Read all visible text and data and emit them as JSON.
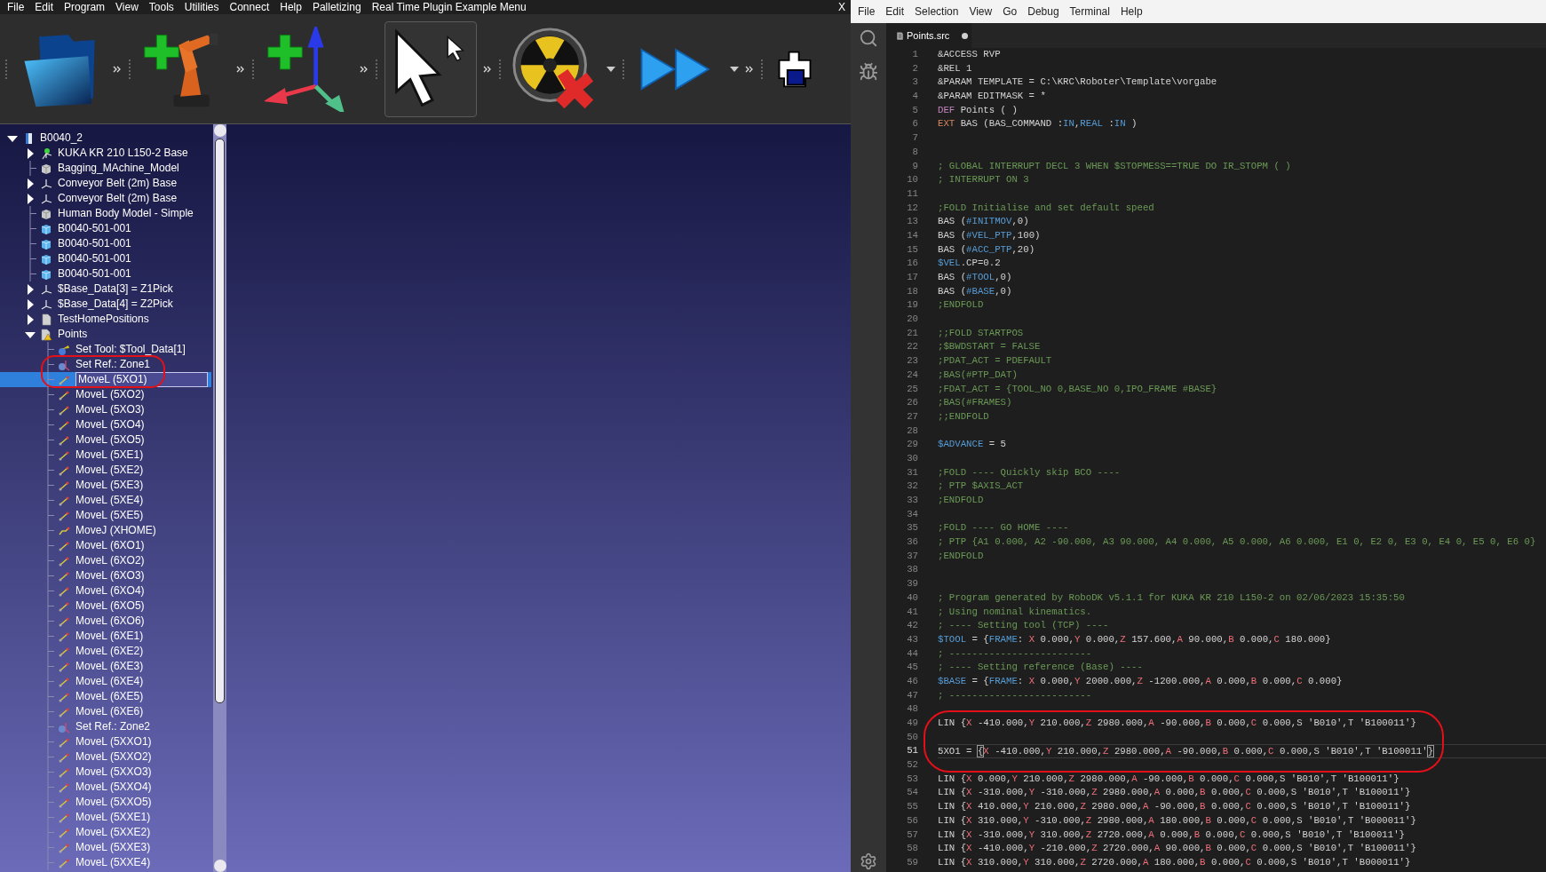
{
  "robodk": {
    "menu": [
      "File",
      "Edit",
      "Program",
      "View",
      "Tools",
      "Utilities",
      "Connect",
      "Help",
      "Palletizing",
      "Real Time Plugin Example Menu"
    ],
    "close": "X",
    "toolbar": [
      {
        "kind": "folder",
        "selected": false,
        "dropdown": false,
        "overflow": true
      },
      {
        "kind": "robot",
        "selected": false,
        "dropdown": false,
        "overflow": true
      },
      {
        "kind": "frame",
        "selected": false,
        "dropdown": false,
        "overflow": true
      },
      {
        "kind": "pointer",
        "selected": true,
        "dropdown": false,
        "overflow": true
      },
      {
        "kind": "radiation",
        "selected": false,
        "dropdown": true,
        "overflow": false
      },
      {
        "kind": "play",
        "selected": false,
        "dropdown": true,
        "overflow": true
      },
      {
        "kind": "print",
        "selected": false,
        "dropdown": false,
        "overflow": false
      }
    ],
    "tree": [
      {
        "label": "B0040_2",
        "kind": "station",
        "expanded": true,
        "selected": false,
        "children": [
          {
            "label": "KUKA KR 210 L150-2 Base",
            "kind": "robot",
            "expanded": false,
            "selected": false
          },
          {
            "label": "Bagging_MAchine_Model",
            "kind": "model",
            "selected": false
          },
          {
            "label": "Conveyor Belt (2m) Base",
            "kind": "frame",
            "expanded": false,
            "selected": false
          },
          {
            "label": "Conveyor Belt (2m) Base",
            "kind": "frame",
            "expanded": false,
            "selected": false
          },
          {
            "label": "Human Body Model - Simple",
            "kind": "model",
            "selected": false
          },
          {
            "label": "B0040-501-001",
            "kind": "part",
            "selected": false
          },
          {
            "label": "B0040-501-001",
            "kind": "part",
            "selected": false
          },
          {
            "label": "B0040-501-001",
            "kind": "part",
            "selected": false
          },
          {
            "label": "B0040-501-001",
            "kind": "part",
            "selected": false
          },
          {
            "label": "$Base_Data[3] = Z1Pick",
            "kind": "frame",
            "expanded": false,
            "selected": false
          },
          {
            "label": "$Base_Data[4] = Z2Pick",
            "kind": "frame",
            "expanded": false,
            "selected": false
          },
          {
            "label": "TestHomePositions",
            "kind": "program",
            "expanded": false,
            "selected": false
          },
          {
            "label": "Points",
            "kind": "program-warning",
            "expanded": true,
            "selected": false,
            "children": [
              {
                "label": "Set Tool: $Tool_Data[1]",
                "kind": "tool",
                "selected": false
              },
              {
                "label": "Set Ref.: Zone1",
                "kind": "reference",
                "selected": false
              },
              {
                "label": "MoveL (5XO1)",
                "kind": "movel",
                "selected": true
              },
              {
                "label": "MoveL (5XO2)",
                "kind": "movel",
                "selected": false
              },
              {
                "label": "MoveL (5XO3)",
                "kind": "movel",
                "selected": false
              },
              {
                "label": "MoveL (5XO4)",
                "kind": "movel",
                "selected": false
              },
              {
                "label": "MoveL (5XO5)",
                "kind": "movel",
                "selected": false
              },
              {
                "label": "MoveL (5XE1)",
                "kind": "movel",
                "selected": false
              },
              {
                "label": "MoveL (5XE2)",
                "kind": "movel",
                "selected": false
              },
              {
                "label": "MoveL (5XE3)",
                "kind": "movel",
                "selected": false
              },
              {
                "label": "MoveL (5XE4)",
                "kind": "movel",
                "selected": false
              },
              {
                "label": "MoveL (5XE5)",
                "kind": "movel",
                "selected": false
              },
              {
                "label": "MoveJ (XHOME)",
                "kind": "movej",
                "selected": false
              },
              {
                "label": "MoveL (6XO1)",
                "kind": "movel",
                "selected": false
              },
              {
                "label": "MoveL (6XO2)",
                "kind": "movel",
                "selected": false
              },
              {
                "label": "MoveL (6XO3)",
                "kind": "movel",
                "selected": false
              },
              {
                "label": "MoveL (6XO4)",
                "kind": "movel",
                "selected": false
              },
              {
                "label": "MoveL (6XO5)",
                "kind": "movel",
                "selected": false
              },
              {
                "label": "MoveL (6XO6)",
                "kind": "movel",
                "selected": false
              },
              {
                "label": "MoveL (6XE1)",
                "kind": "movel",
                "selected": false
              },
              {
                "label": "MoveL (6XE2)",
                "kind": "movel",
                "selected": false
              },
              {
                "label": "MoveL (6XE3)",
                "kind": "movel",
                "selected": false
              },
              {
                "label": "MoveL (6XE4)",
                "kind": "movel",
                "selected": false
              },
              {
                "label": "MoveL (6XE5)",
                "kind": "movel",
                "selected": false
              },
              {
                "label": "MoveL (6XE6)",
                "kind": "movel",
                "selected": false
              },
              {
                "label": "Set Ref.: Zone2",
                "kind": "reference",
                "selected": false
              },
              {
                "label": "MoveL (5XXO1)",
                "kind": "movel",
                "selected": false
              },
              {
                "label": "MoveL (5XXO2)",
                "kind": "movel",
                "selected": false
              },
              {
                "label": "MoveL (5XXO3)",
                "kind": "movel",
                "selected": false
              },
              {
                "label": "MoveL (5XXO4)",
                "kind": "movel",
                "selected": false
              },
              {
                "label": "MoveL (5XXO5)",
                "kind": "movel",
                "selected": false
              },
              {
                "label": "MoveL (5XXE1)",
                "kind": "movel",
                "selected": false
              },
              {
                "label": "MoveL (5XXE2)",
                "kind": "movel",
                "selected": false
              },
              {
                "label": "MoveL (5XXE3)",
                "kind": "movel",
                "selected": false
              },
              {
                "label": "MoveL (5XXE4)",
                "kind": "movel",
                "selected": false
              }
            ]
          }
        ]
      }
    ]
  },
  "editor": {
    "menu": [
      "File",
      "Edit",
      "Selection",
      "View",
      "Go",
      "Debug",
      "Terminal",
      "Help"
    ],
    "tab": {
      "title": "Points.src",
      "modified": true
    },
    "lines": [
      {
        "number": "1",
        "current": false,
        "segments": [
          {
            "kind": "plain",
            "text": "&ACCESS RVP"
          }
        ]
      },
      {
        "number": "2",
        "current": false,
        "segments": [
          {
            "kind": "plain",
            "text": "&REL 1"
          }
        ]
      },
      {
        "number": "3",
        "current": false,
        "segments": [
          {
            "kind": "plain",
            "text": "&PARAM TEMPLATE = C:\\KRC\\Roboter\\Template\\vorgabe"
          }
        ]
      },
      {
        "number": "4",
        "current": false,
        "segments": [
          {
            "kind": "plain",
            "text": "&PARAM EDITMASK = *"
          }
        ]
      },
      {
        "number": "5",
        "current": false,
        "segments": [
          {
            "kind": "def",
            "text": "DEF"
          },
          {
            "kind": "plain",
            "text": " Points ( )"
          }
        ]
      },
      {
        "number": "6",
        "current": false,
        "segments": [
          {
            "kind": "ext",
            "text": "EXT"
          },
          {
            "kind": "plain",
            "text": " BAS (BAS_COMMAND :"
          },
          {
            "kind": "var",
            "text": "IN"
          },
          {
            "kind": "plain",
            "text": ","
          },
          {
            "kind": "var",
            "text": "REAL"
          },
          {
            "kind": "plain",
            "text": " :"
          },
          {
            "kind": "var",
            "text": "IN"
          },
          {
            "kind": "plain",
            "text": " )"
          }
        ]
      },
      {
        "number": "7",
        "current": false
      },
      {
        "number": "8",
        "current": false
      },
      {
        "number": "9",
        "current": false,
        "segments": [
          {
            "kind": "comment",
            "text": "; GLOBAL INTERRUPT DECL 3 WHEN $STOPMESS==TRUE DO IR_STOPM ( )"
          }
        ]
      },
      {
        "number": "10",
        "current": false,
        "segments": [
          {
            "kind": "comment",
            "text": "; INTERRUPT ON 3"
          }
        ]
      },
      {
        "number": "11",
        "current": false
      },
      {
        "number": "12",
        "current": false,
        "segments": [
          {
            "kind": "comment",
            "text": ";FOLD Initialise and set default speed"
          }
        ]
      },
      {
        "number": "13",
        "current": false,
        "segments": [
          {
            "kind": "plain",
            "text": "BAS ("
          },
          {
            "kind": "var",
            "text": "#INITMOV"
          },
          {
            "kind": "plain",
            "text": ",0)"
          }
        ]
      },
      {
        "number": "14",
        "current": false,
        "segments": [
          {
            "kind": "plain",
            "text": "BAS ("
          },
          {
            "kind": "var",
            "text": "#VEL_PTP"
          },
          {
            "kind": "plain",
            "text": ",100)"
          }
        ]
      },
      {
        "number": "15",
        "current": false,
        "segments": [
          {
            "kind": "plain",
            "text": "BAS ("
          },
          {
            "kind": "var",
            "text": "#ACC_PTP"
          },
          {
            "kind": "plain",
            "text": ",20)"
          }
        ]
      },
      {
        "number": "16",
        "current": false,
        "segments": [
          {
            "kind": "var",
            "text": "$VEL"
          },
          {
            "kind": "plain",
            "text": ".CP=0.2"
          }
        ]
      },
      {
        "number": "17",
        "current": false,
        "segments": [
          {
            "kind": "plain",
            "text": "BAS ("
          },
          {
            "kind": "var",
            "text": "#TOOL"
          },
          {
            "kind": "plain",
            "text": ",0)"
          }
        ]
      },
      {
        "number": "18",
        "current": false,
        "segments": [
          {
            "kind": "plain",
            "text": "BAS ("
          },
          {
            "kind": "var",
            "text": "#BASE"
          },
          {
            "kind": "plain",
            "text": ",0)"
          }
        ]
      },
      {
        "number": "19",
        "current": false,
        "segments": [
          {
            "kind": "comment",
            "text": ";ENDFOLD"
          }
        ]
      },
      {
        "number": "20",
        "current": false
      },
      {
        "number": "21",
        "current": false,
        "segments": [
          {
            "kind": "comment",
            "text": ";;FOLD STARTPOS"
          }
        ]
      },
      {
        "number": "22",
        "current": false,
        "segments": [
          {
            "kind": "comment",
            "text": ";$BWDSTART = FALSE"
          }
        ]
      },
      {
        "number": "23",
        "current": false,
        "segments": [
          {
            "kind": "comment",
            "text": ";PDAT_ACT = PDEFAULT"
          }
        ]
      },
      {
        "number": "24",
        "current": false,
        "segments": [
          {
            "kind": "comment",
            "text": ";BAS(#PTP_DAT)"
          }
        ]
      },
      {
        "number": "25",
        "current": false,
        "segments": [
          {
            "kind": "comment",
            "text": ";FDAT_ACT = {TOOL_NO 0,BASE_NO 0,IPO_FRAME #BASE}"
          }
        ]
      },
      {
        "number": "26",
        "current": false,
        "segments": [
          {
            "kind": "comment",
            "text": ";BAS(#FRAMES)"
          }
        ]
      },
      {
        "number": "27",
        "current": false,
        "segments": [
          {
            "kind": "comment",
            "text": ";;ENDFOLD"
          }
        ]
      },
      {
        "number": "28",
        "current": false
      },
      {
        "number": "29",
        "current": false,
        "segments": [
          {
            "kind": "var",
            "text": "$ADVANCE"
          },
          {
            "kind": "plain",
            "text": " = 5"
          }
        ]
      },
      {
        "number": "30",
        "current": false
      },
      {
        "number": "31",
        "current": false,
        "segments": [
          {
            "kind": "comment",
            "text": ";FOLD ---- Quickly skip BCO ----"
          }
        ]
      },
      {
        "number": "32",
        "current": false,
        "segments": [
          {
            "kind": "comment",
            "text": "; PTP $AXIS_ACT"
          }
        ]
      },
      {
        "number": "33",
        "current": false,
        "segments": [
          {
            "kind": "comment",
            "text": ";ENDFOLD"
          }
        ]
      },
      {
        "number": "34",
        "current": false
      },
      {
        "number": "35",
        "current": false,
        "segments": [
          {
            "kind": "comment",
            "text": ";FOLD ---- GO HOME ----"
          }
        ]
      },
      {
        "number": "36",
        "current": false,
        "segments": [
          {
            "kind": "comment",
            "text": "; PTP {A1 0.000, A2 -90.000, A3 90.000, A4 0.000, A5 0.000, A6 0.000, E1 0, E2 0, E3 0, E4 0, E5 0, E6 0}"
          }
        ]
      },
      {
        "number": "37",
        "current": false,
        "segments": [
          {
            "kind": "comment",
            "text": ";ENDFOLD"
          }
        ]
      },
      {
        "number": "38",
        "current": false
      },
      {
        "number": "39",
        "current": false
      },
      {
        "number": "40",
        "current": false,
        "segments": [
          {
            "kind": "comment",
            "text": "; Program generated by RoboDK v5.1.1 for KUKA KR 210 L150-2 on 02/06/2023 15:35:50"
          }
        ]
      },
      {
        "number": "41",
        "current": false,
        "segments": [
          {
            "kind": "comment",
            "text": "; Using nominal kinematics."
          }
        ]
      },
      {
        "number": "42",
        "current": false,
        "segments": [
          {
            "kind": "comment",
            "text": "; ---- Setting tool (TCP) ----"
          }
        ]
      },
      {
        "number": "43",
        "current": false,
        "segments": [
          {
            "kind": "var",
            "text": "$TOOL"
          },
          {
            "kind": "plain",
            "text": " = {"
          },
          {
            "kind": "var",
            "text": "FRAME"
          },
          {
            "kind": "plain",
            "text": ": "
          },
          {
            "kind": "axis",
            "text": "X"
          },
          {
            "kind": "plain",
            "text": " 0.000,"
          },
          {
            "kind": "axis",
            "text": "Y"
          },
          {
            "kind": "plain",
            "text": " 0.000,"
          },
          {
            "kind": "axis",
            "text": "Z"
          },
          {
            "kind": "plain",
            "text": " 157.600,"
          },
          {
            "kind": "axis",
            "text": "A"
          },
          {
            "kind": "plain",
            "text": " 90.000,"
          },
          {
            "kind": "axis",
            "text": "B"
          },
          {
            "kind": "plain",
            "text": " 0.000,"
          },
          {
            "kind": "axis",
            "text": "C"
          },
          {
            "kind": "plain",
            "text": " 180.000}"
          }
        ]
      },
      {
        "number": "44",
        "current": false,
        "segments": [
          {
            "kind": "comment",
            "text": "; -------------------------"
          }
        ]
      },
      {
        "number": "45",
        "current": false,
        "segments": [
          {
            "kind": "comment",
            "text": "; ---- Setting reference (Base) ----"
          }
        ]
      },
      {
        "number": "46",
        "current": false,
        "segments": [
          {
            "kind": "var",
            "text": "$BASE"
          },
          {
            "kind": "plain",
            "text": " = {"
          },
          {
            "kind": "var",
            "text": "FRAME"
          },
          {
            "kind": "plain",
            "text": ": "
          },
          {
            "kind": "axis",
            "text": "X"
          },
          {
            "kind": "plain",
            "text": " 0.000,"
          },
          {
            "kind": "axis",
            "text": "Y"
          },
          {
            "kind": "plain",
            "text": " 2000.000,"
          },
          {
            "kind": "axis",
            "text": "Z"
          },
          {
            "kind": "plain",
            "text": " -1200.000,"
          },
          {
            "kind": "axis",
            "text": "A"
          },
          {
            "kind": "plain",
            "text": " 0.000,"
          },
          {
            "kind": "axis",
            "text": "B"
          },
          {
            "kind": "plain",
            "text": " 0.000,"
          },
          {
            "kind": "axis",
            "text": "C"
          },
          {
            "kind": "plain",
            "text": " 0.000}"
          }
        ]
      },
      {
        "number": "47",
        "current": false,
        "segments": [
          {
            "kind": "comment",
            "text": "; -------------------------"
          }
        ]
      },
      {
        "number": "48",
        "current": false
      },
      {
        "number": "49",
        "current": false,
        "segments": [
          {
            "kind": "plain",
            "text": "LIN {"
          },
          {
            "kind": "axis",
            "text": "X"
          },
          {
            "kind": "plain",
            "text": " -410.000,"
          },
          {
            "kind": "axis",
            "text": "Y"
          },
          {
            "kind": "plain",
            "text": " 210.000,"
          },
          {
            "kind": "axis",
            "text": "Z"
          },
          {
            "kind": "plain",
            "text": " 2980.000,"
          },
          {
            "kind": "axis",
            "text": "A"
          },
          {
            "kind": "plain",
            "text": " -90.000,"
          },
          {
            "kind": "axis",
            "text": "B"
          },
          {
            "kind": "plain",
            "text": " 0.000,"
          },
          {
            "kind": "axis",
            "text": "C"
          },
          {
            "kind": "plain",
            "text": " 0.000,S 'B010',T 'B100011'}"
          }
        ]
      },
      {
        "number": "50",
        "current": false
      },
      {
        "number": "51",
        "current": true,
        "segments": [
          {
            "kind": "plain",
            "text": "5XO1 = "
          },
          {
            "kind": "cursor",
            "text": "{"
          },
          {
            "kind": "axis",
            "text": "X"
          },
          {
            "kind": "plain",
            "text": " -410.000,"
          },
          {
            "kind": "axis",
            "text": "Y"
          },
          {
            "kind": "plain",
            "text": " 210.000,"
          },
          {
            "kind": "axis",
            "text": "Z"
          },
          {
            "kind": "plain",
            "text": " 2980.000,"
          },
          {
            "kind": "axis",
            "text": "A"
          },
          {
            "kind": "plain",
            "text": " -90.000,"
          },
          {
            "kind": "axis",
            "text": "B"
          },
          {
            "kind": "plain",
            "text": " 0.000,"
          },
          {
            "kind": "axis",
            "text": "C"
          },
          {
            "kind": "plain",
            "text": " 0.000,S 'B010',T 'B100011'"
          },
          {
            "kind": "cursor",
            "text": "}"
          }
        ]
      },
      {
        "number": "52",
        "current": false
      },
      {
        "number": "53",
        "current": false,
        "segments": [
          {
            "kind": "plain",
            "text": "LIN {"
          },
          {
            "kind": "axis",
            "text": "X"
          },
          {
            "kind": "plain",
            "text": " 0.000,"
          },
          {
            "kind": "axis",
            "text": "Y"
          },
          {
            "kind": "plain",
            "text": " 210.000,"
          },
          {
            "kind": "axis",
            "text": "Z"
          },
          {
            "kind": "plain",
            "text": " 2980.000,"
          },
          {
            "kind": "axis",
            "text": "A"
          },
          {
            "kind": "plain",
            "text": " -90.000,"
          },
          {
            "kind": "axis",
            "text": "B"
          },
          {
            "kind": "plain",
            "text": " 0.000,"
          },
          {
            "kind": "axis",
            "text": "C"
          },
          {
            "kind": "plain",
            "text": " 0.000,S 'B010',T 'B100011'}"
          }
        ]
      },
      {
        "number": "54",
        "current": false,
        "segments": [
          {
            "kind": "plain",
            "text": "LIN {"
          },
          {
            "kind": "axis",
            "text": "X"
          },
          {
            "kind": "plain",
            "text": " -310.000,"
          },
          {
            "kind": "axis",
            "text": "Y"
          },
          {
            "kind": "plain",
            "text": " -310.000,"
          },
          {
            "kind": "axis",
            "text": "Z"
          },
          {
            "kind": "plain",
            "text": " 2980.000,"
          },
          {
            "kind": "axis",
            "text": "A"
          },
          {
            "kind": "plain",
            "text": " 0.000,"
          },
          {
            "kind": "axis",
            "text": "B"
          },
          {
            "kind": "plain",
            "text": " 0.000,"
          },
          {
            "kind": "axis",
            "text": "C"
          },
          {
            "kind": "plain",
            "text": " 0.000,S 'B010',T 'B100011'}"
          }
        ]
      },
      {
        "number": "55",
        "current": false,
        "segments": [
          {
            "kind": "plain",
            "text": "LIN {"
          },
          {
            "kind": "axis",
            "text": "X"
          },
          {
            "kind": "plain",
            "text": " 410.000,"
          },
          {
            "kind": "axis",
            "text": "Y"
          },
          {
            "kind": "plain",
            "text": " 210.000,"
          },
          {
            "kind": "axis",
            "text": "Z"
          },
          {
            "kind": "plain",
            "text": " 2980.000,"
          },
          {
            "kind": "axis",
            "text": "A"
          },
          {
            "kind": "plain",
            "text": " -90.000,"
          },
          {
            "kind": "axis",
            "text": "B"
          },
          {
            "kind": "plain",
            "text": " 0.000,"
          },
          {
            "kind": "axis",
            "text": "C"
          },
          {
            "kind": "plain",
            "text": " 0.000,S 'B010',T 'B100011'}"
          }
        ]
      },
      {
        "number": "56",
        "current": false,
        "segments": [
          {
            "kind": "plain",
            "text": "LIN {"
          },
          {
            "kind": "axis",
            "text": "X"
          },
          {
            "kind": "plain",
            "text": " 310.000,"
          },
          {
            "kind": "axis",
            "text": "Y"
          },
          {
            "kind": "plain",
            "text": " -310.000,"
          },
          {
            "kind": "axis",
            "text": "Z"
          },
          {
            "kind": "plain",
            "text": " 2980.000,"
          },
          {
            "kind": "axis",
            "text": "A"
          },
          {
            "kind": "plain",
            "text": " 180.000,"
          },
          {
            "kind": "axis",
            "text": "B"
          },
          {
            "kind": "plain",
            "text": " 0.000,"
          },
          {
            "kind": "axis",
            "text": "C"
          },
          {
            "kind": "plain",
            "text": " 0.000,S 'B010',T 'B000011'}"
          }
        ]
      },
      {
        "number": "57",
        "current": false,
        "segments": [
          {
            "kind": "plain",
            "text": "LIN {"
          },
          {
            "kind": "axis",
            "text": "X"
          },
          {
            "kind": "plain",
            "text": " -310.000,"
          },
          {
            "kind": "axis",
            "text": "Y"
          },
          {
            "kind": "plain",
            "text": " 310.000,"
          },
          {
            "kind": "axis",
            "text": "Z"
          },
          {
            "kind": "plain",
            "text": " 2720.000,"
          },
          {
            "kind": "axis",
            "text": "A"
          },
          {
            "kind": "plain",
            "text": " 0.000,"
          },
          {
            "kind": "axis",
            "text": "B"
          },
          {
            "kind": "plain",
            "text": " 0.000,"
          },
          {
            "kind": "axis",
            "text": "C"
          },
          {
            "kind": "plain",
            "text": " 0.000,S 'B010',T 'B100011'}"
          }
        ]
      },
      {
        "number": "58",
        "current": false,
        "segments": [
          {
            "kind": "plain",
            "text": "LIN {"
          },
          {
            "kind": "axis",
            "text": "X"
          },
          {
            "kind": "plain",
            "text": " -410.000,"
          },
          {
            "kind": "axis",
            "text": "Y"
          },
          {
            "kind": "plain",
            "text": " -210.000,"
          },
          {
            "kind": "axis",
            "text": "Z"
          },
          {
            "kind": "plain",
            "text": " 2720.000,"
          },
          {
            "kind": "axis",
            "text": "A"
          },
          {
            "kind": "plain",
            "text": " 90.000,"
          },
          {
            "kind": "axis",
            "text": "B"
          },
          {
            "kind": "plain",
            "text": " 0.000,"
          },
          {
            "kind": "axis",
            "text": "C"
          },
          {
            "kind": "plain",
            "text": " 0.000,S 'B010',T 'B100011'}"
          }
        ]
      },
      {
        "number": "59",
        "current": false,
        "segments": [
          {
            "kind": "plain",
            "text": "LIN {"
          },
          {
            "kind": "axis",
            "text": "X"
          },
          {
            "kind": "plain",
            "text": " 310.000,"
          },
          {
            "kind": "axis",
            "text": "Y"
          },
          {
            "kind": "plain",
            "text": " 310.000,"
          },
          {
            "kind": "axis",
            "text": "Z"
          },
          {
            "kind": "plain",
            "text": " 2720.000,"
          },
          {
            "kind": "axis",
            "text": "A"
          },
          {
            "kind": "plain",
            "text": " 180.000,"
          },
          {
            "kind": "axis",
            "text": "B"
          },
          {
            "kind": "plain",
            "text": " 0.000,"
          },
          {
            "kind": "axis",
            "text": "C"
          },
          {
            "kind": "plain",
            "text": " 0.000,S 'B010',T 'B000011'}"
          }
        ]
      }
    ]
  }
}
